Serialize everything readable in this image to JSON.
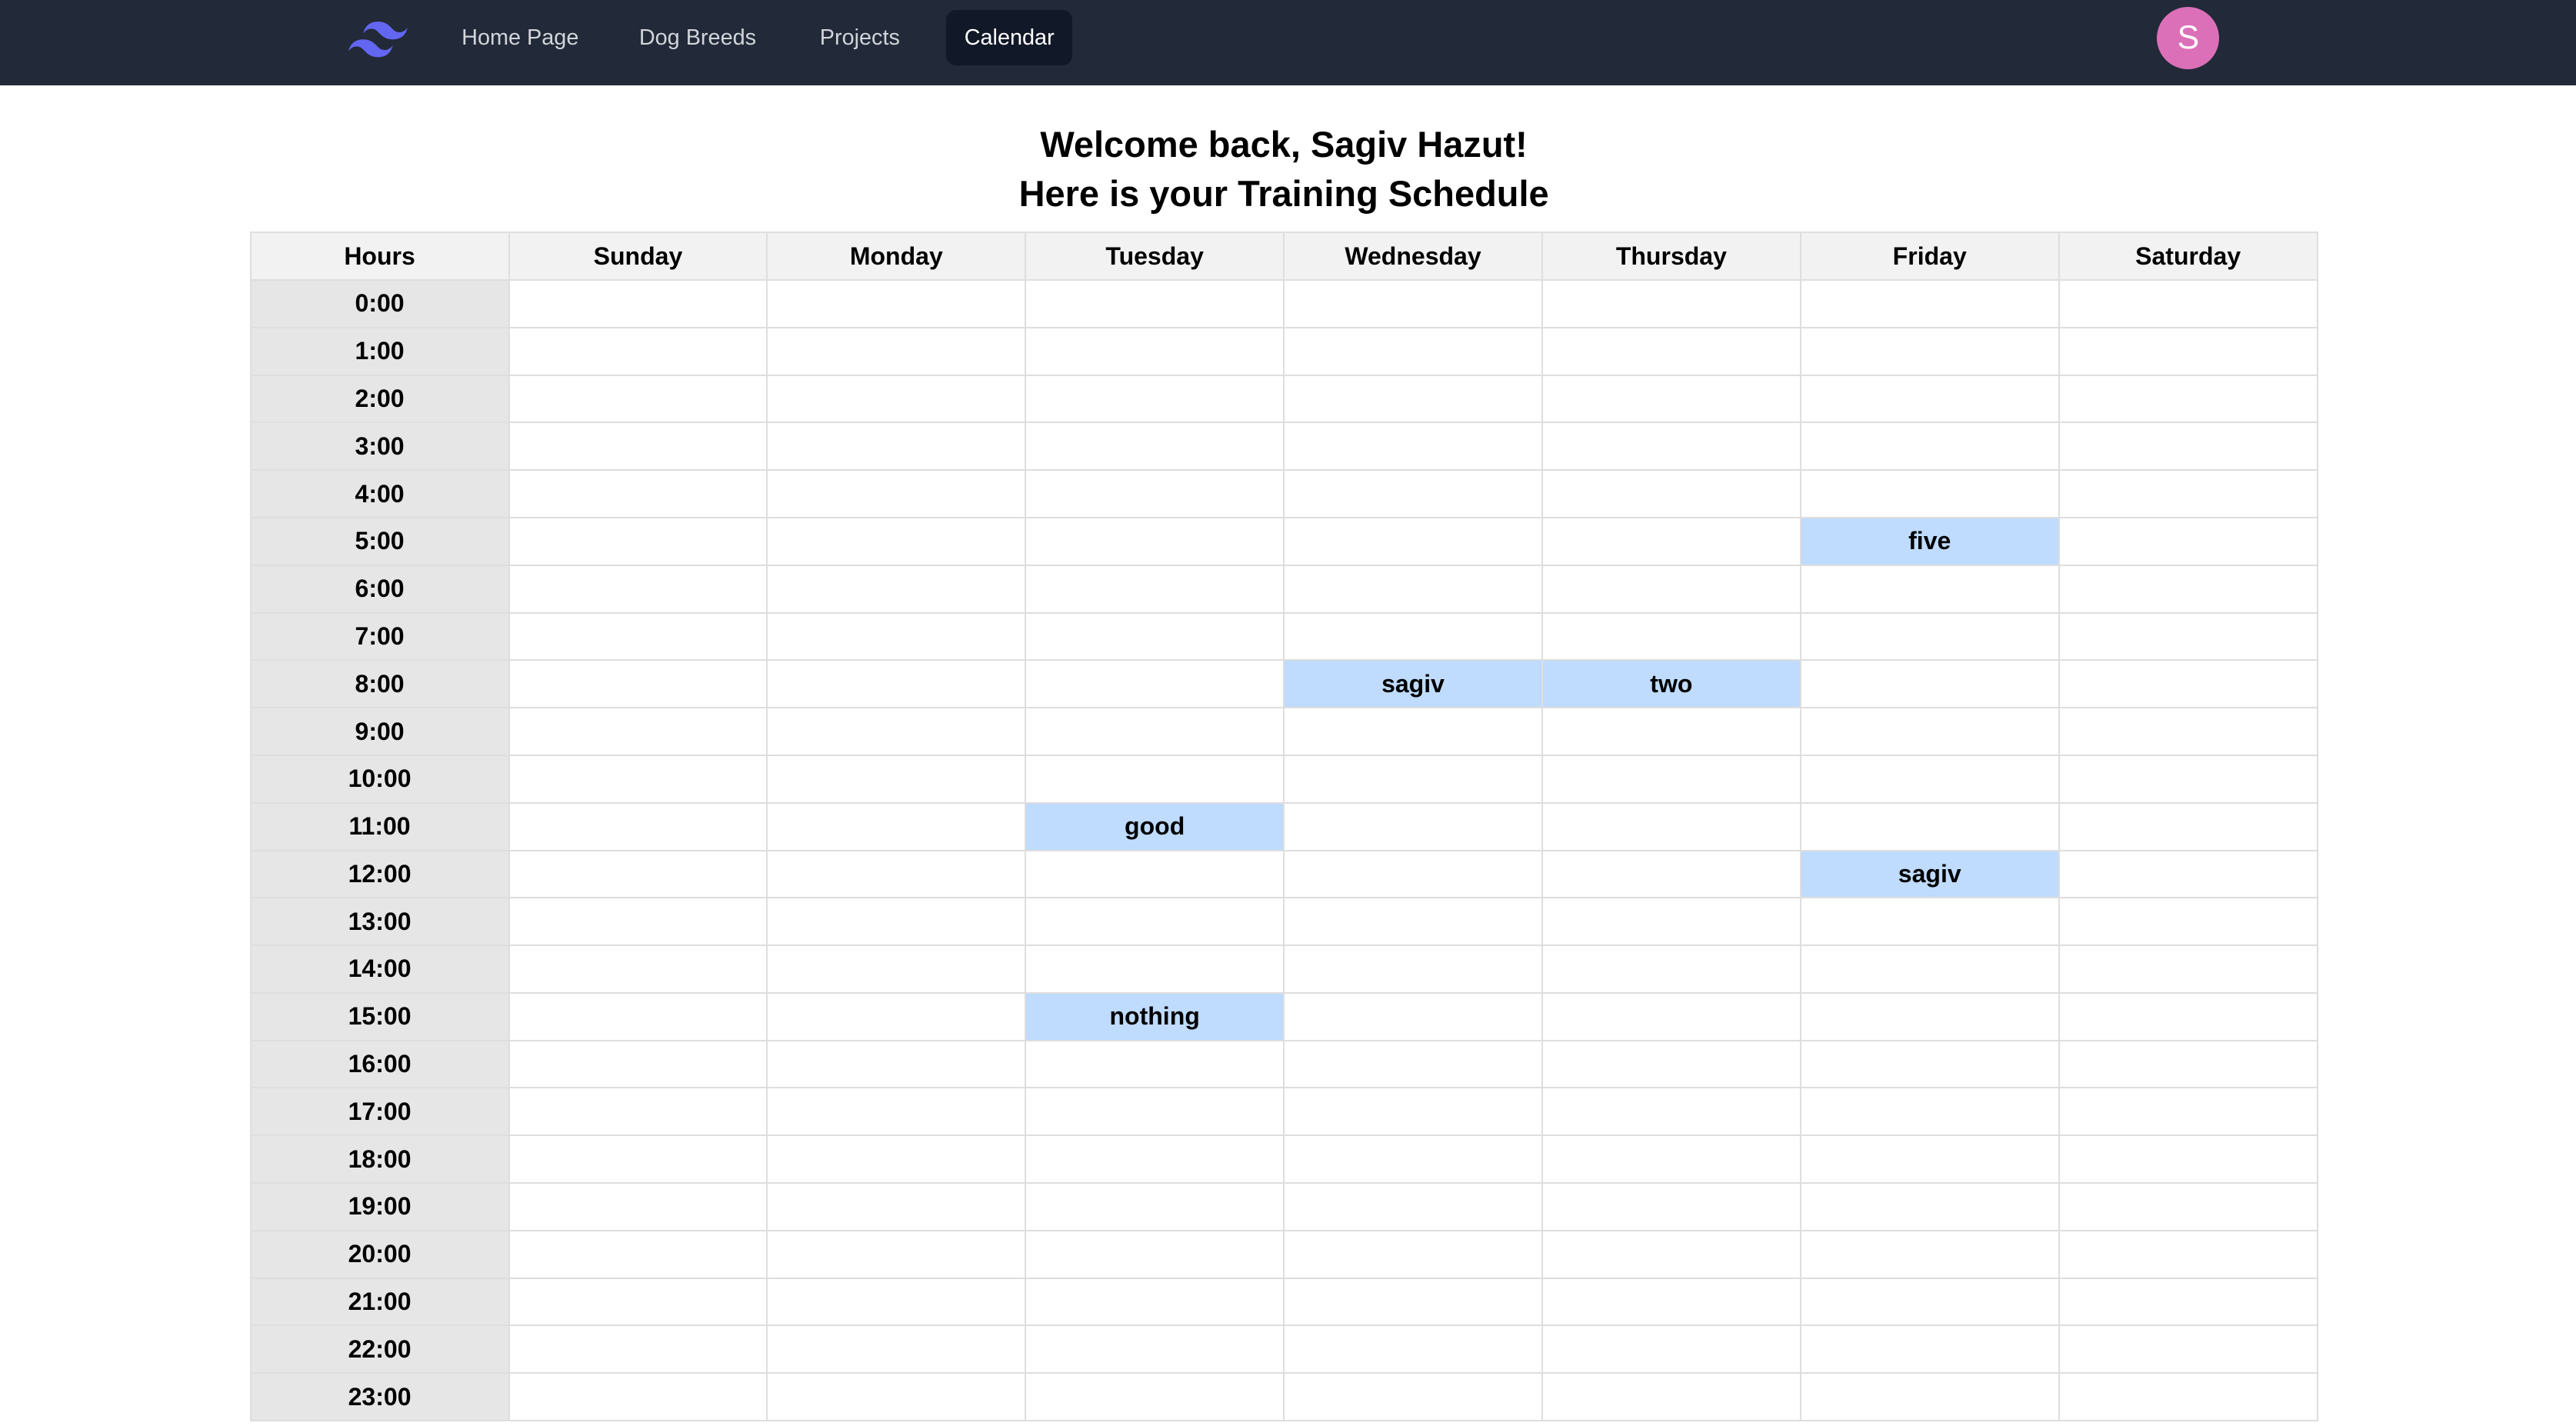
{
  "nav": {
    "logo": "tailwind-logo",
    "links": [
      {
        "label": "Home Page",
        "active": false
      },
      {
        "label": "Dog Breeds",
        "active": false
      },
      {
        "label": "Projects",
        "active": false
      },
      {
        "label": "Calendar",
        "active": true
      }
    ],
    "avatar_initial": "S",
    "avatar_color": "#db70b8"
  },
  "heading": {
    "line1": "Welcome back, Sagiv Hazut!",
    "line2": "Here is your Training Schedule"
  },
  "calendar": {
    "hours_header": "Hours",
    "days": [
      "Sunday",
      "Monday",
      "Tuesday",
      "Wednesday",
      "Thursday",
      "Friday",
      "Saturday"
    ],
    "hours": [
      "0:00",
      "1:00",
      "2:00",
      "3:00",
      "4:00",
      "5:00",
      "6:00",
      "7:00",
      "8:00",
      "9:00",
      "10:00",
      "11:00",
      "12:00",
      "13:00",
      "14:00",
      "15:00",
      "16:00",
      "17:00",
      "18:00",
      "19:00",
      "20:00",
      "21:00",
      "22:00",
      "23:00"
    ],
    "event_color": "#bfdbfe",
    "events": [
      {
        "day": "Friday",
        "hour": "5:00",
        "label": "five"
      },
      {
        "day": "Wednesday",
        "hour": "8:00",
        "label": "sagiv"
      },
      {
        "day": "Thursday",
        "hour": "8:00",
        "label": "two"
      },
      {
        "day": "Tuesday",
        "hour": "11:00",
        "label": "good"
      },
      {
        "day": "Friday",
        "hour": "12:00",
        "label": "sagiv"
      },
      {
        "day": "Tuesday",
        "hour": "15:00",
        "label": "nothing"
      }
    ]
  }
}
